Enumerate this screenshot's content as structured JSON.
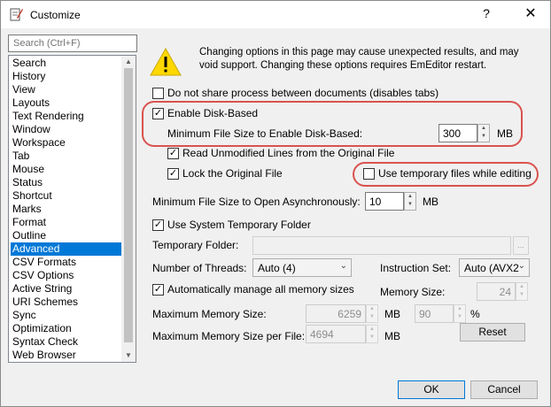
{
  "window": {
    "title": "Customize",
    "help_glyph": "?",
    "close_glyph": "✕"
  },
  "search": {
    "placeholder": "Search (Ctrl+F)"
  },
  "sidebar": {
    "items": [
      "Search",
      "History",
      "View",
      "Layouts",
      "Text Rendering",
      "Window",
      "Workspace",
      "Tab",
      "Mouse",
      "Status",
      "Shortcut",
      "Marks",
      "Format",
      "Outline",
      "Advanced",
      "CSV Formats",
      "CSV Options",
      "Active String",
      "URI Schemes",
      "Sync",
      "Optimization",
      "Syntax Check",
      "Web Browser"
    ],
    "selected": "Advanced"
  },
  "warning": {
    "icon": "warning-triangle-icon",
    "text": "Changing options in this page may cause unexpected results, and may void support. Changing these options requires EmEditor restart."
  },
  "options": {
    "no_share": {
      "label": "Do not share process between documents (disables tabs)",
      "checked": false
    },
    "disk_based": {
      "label": "Enable Disk-Based",
      "checked": true
    },
    "min_disk_size": {
      "label": "Minimum File Size to Enable Disk-Based:",
      "value": "300",
      "unit": "MB"
    },
    "read_unmodified": {
      "label": "Read Unmodified Lines from the Original File",
      "checked": true
    },
    "lock_original": {
      "label": "Lock the Original File",
      "checked": true
    },
    "use_temp_files": {
      "label": "Use temporary files while editing",
      "checked": false
    },
    "min_async": {
      "label": "Minimum File Size to Open Asynchronously:",
      "value": "10",
      "unit": "MB"
    },
    "use_sys_temp": {
      "label": "Use System Temporary Folder",
      "checked": true
    },
    "temp_folder": {
      "label": "Temporary Folder:",
      "value": "",
      "browse": "..."
    },
    "threads": {
      "label": "Number of Threads:",
      "value": "Auto (4)"
    },
    "instruction_set": {
      "label": "Instruction Set:",
      "value": "Auto (AVX2"
    },
    "auto_memory": {
      "label": "Automatically manage all memory sizes",
      "checked": true
    },
    "memory_size": {
      "label": "Memory Size:",
      "value": "24"
    },
    "max_memory": {
      "label": "Maximum Memory Size:",
      "value": "6259",
      "unit": "MB",
      "percent": "90",
      "percent_unit": "%"
    },
    "max_memory_file": {
      "label": "Maximum Memory Size per File:",
      "value": "4694",
      "unit": "MB"
    },
    "reset_label": "Reset"
  },
  "footer": {
    "ok_label": "OK",
    "cancel_label": "Cancel"
  },
  "colors": {
    "selection": "#0078d7",
    "highlight": "#d9534f"
  }
}
